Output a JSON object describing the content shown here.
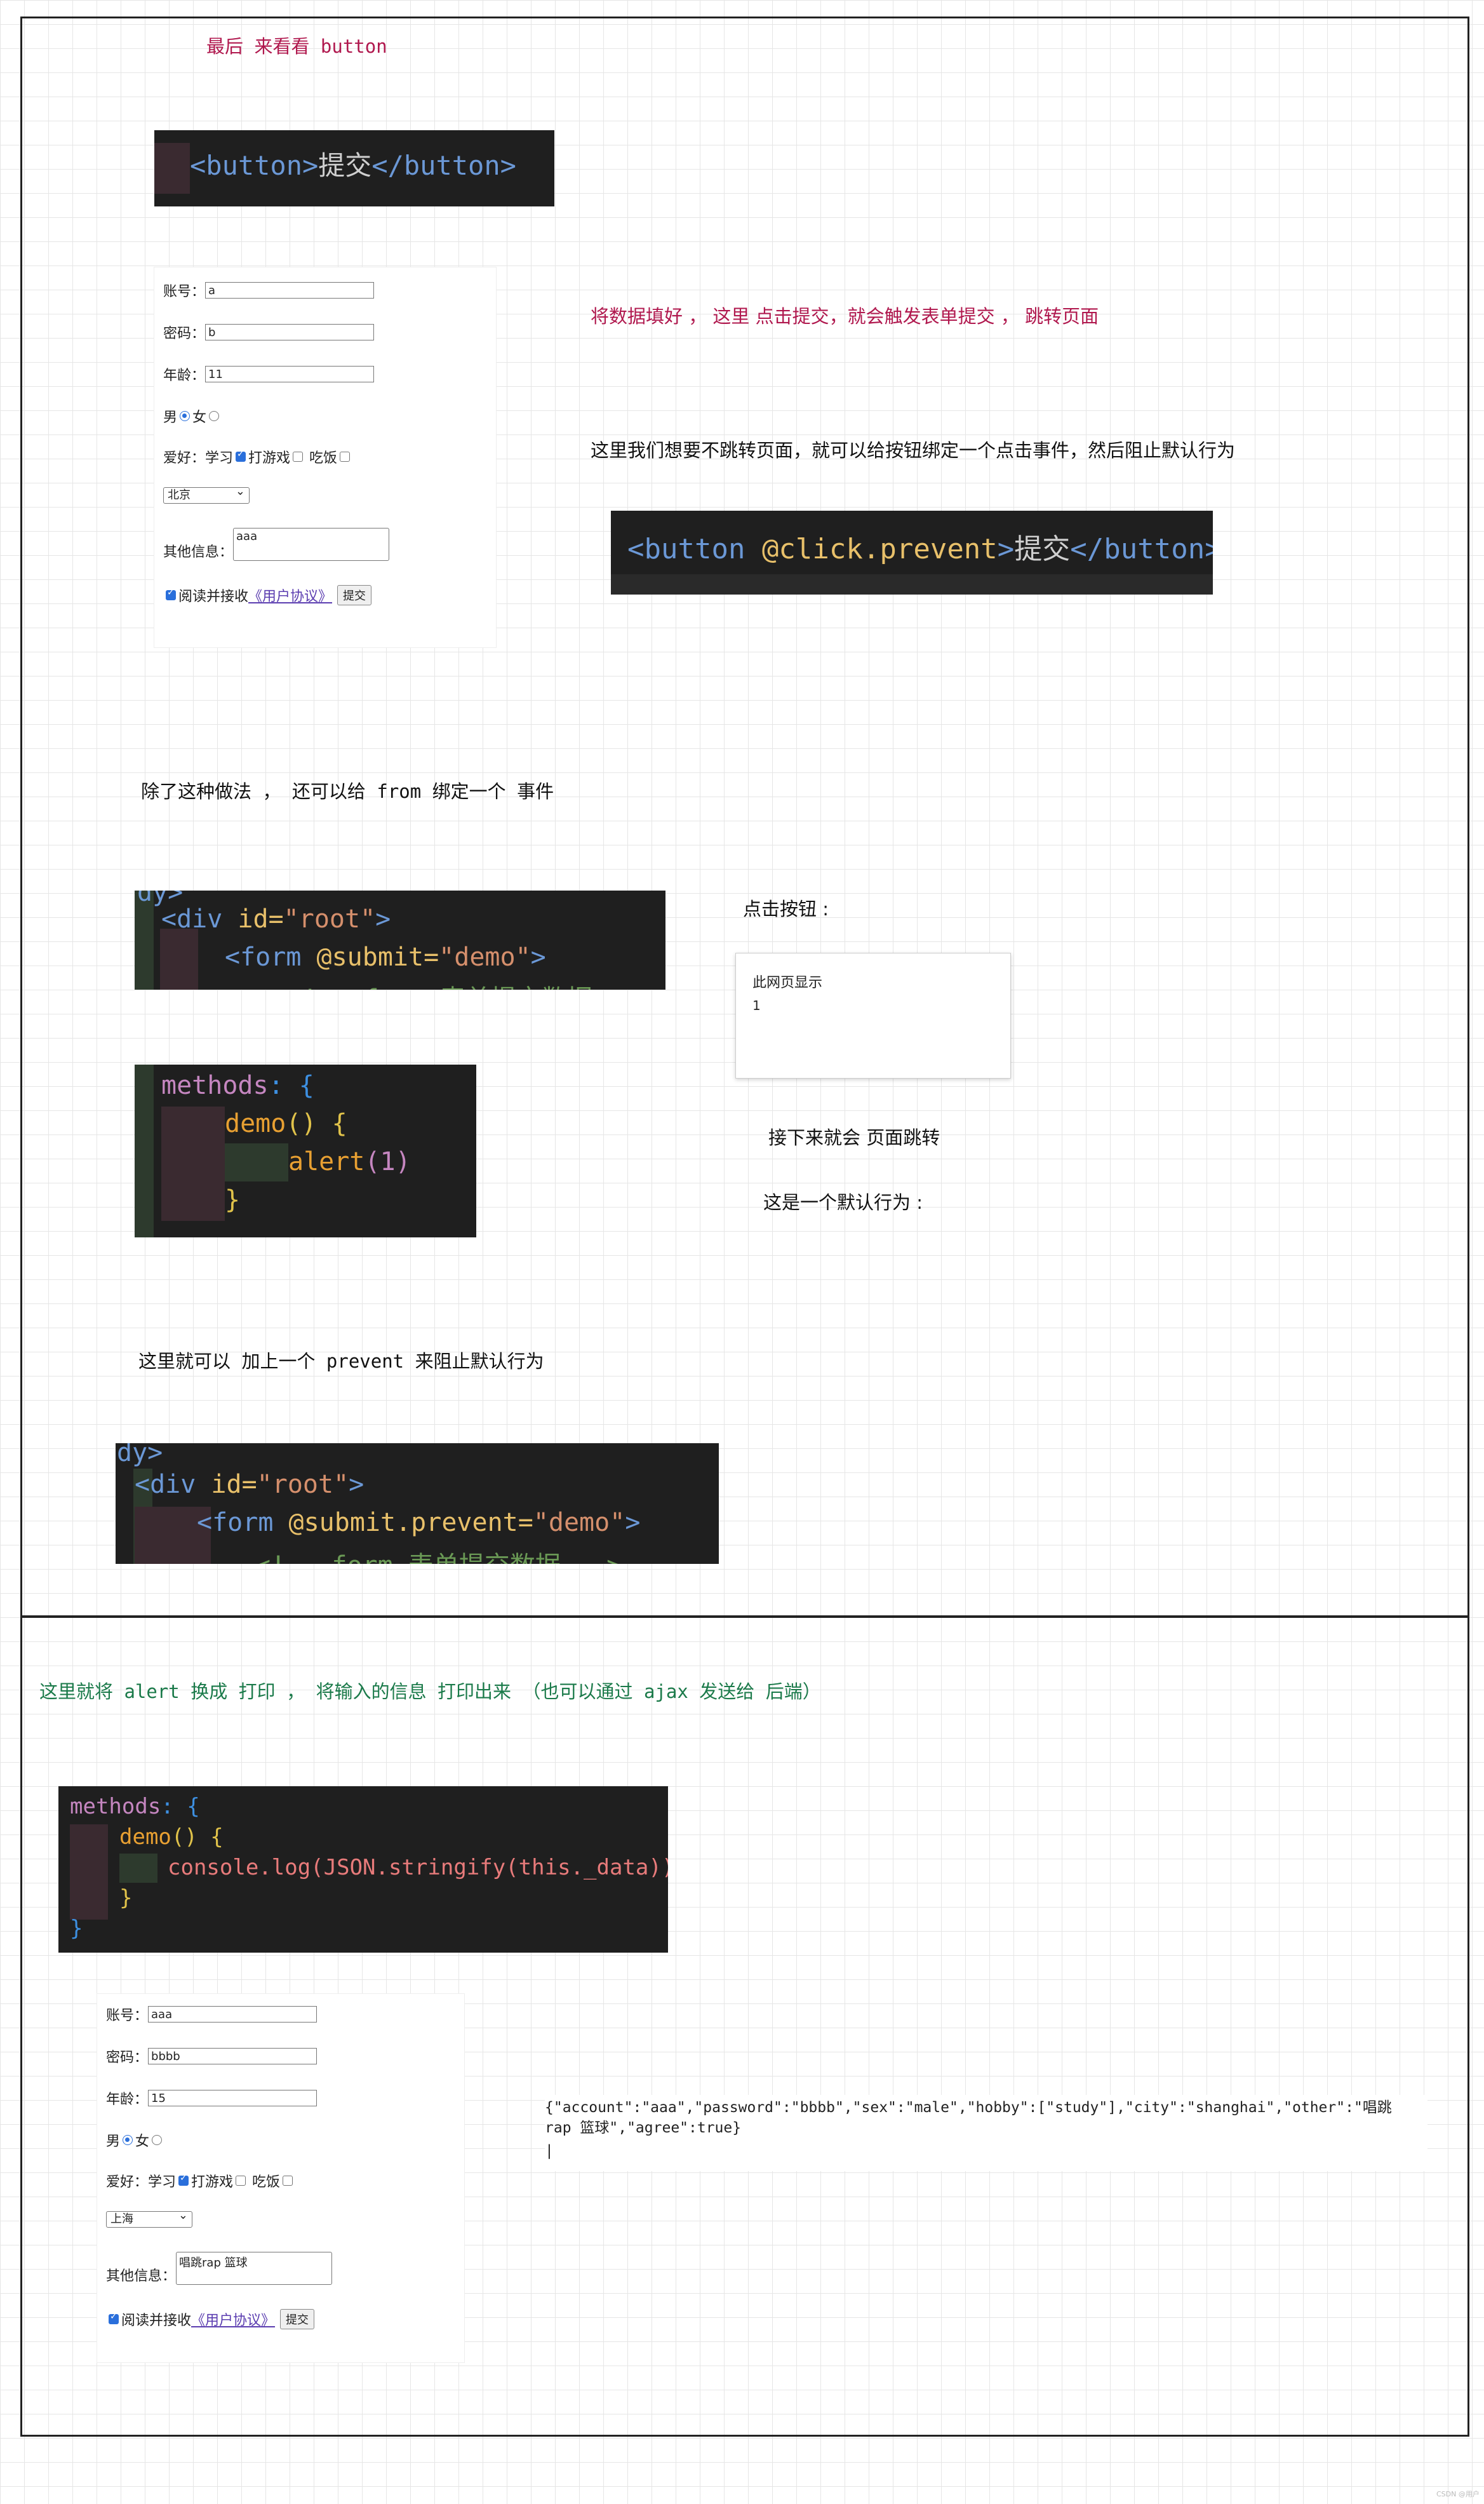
{
  "notes": {
    "finally_button": "最后  来看看  button",
    "fill_data": "将数据填好 ，   这里  点击提交，就会触发表单提交 ，   跳转页面",
    "no_jump": "这里我们想要不跳转页面，就可以给按钮绑定一个点击事件，然后阻止默认行为",
    "besides": "除了这种做法 ， 还可以给  from  绑定一个  事件",
    "click_button": "点击按钮  :",
    "then_jump": "接下来就会  页面跳转",
    "default_behavior": "这是一个默认行为  :",
    "add_prevent": "这里就可以  加上一个  prevent  来阻止默认行为",
    "console_log": "这里就将  alert  换成  打印 ， 将输入的信息  打印出来  （也可以通过  ajax  发送给  后端）"
  },
  "code": {
    "button_plain": {
      "open": "<button>",
      "text": "提交",
      "close": "</button>"
    },
    "button_prevent": {
      "open": "<button ",
      "attr": "@click.prevent",
      "gt": ">",
      "text": "提交",
      "close": "</button>"
    },
    "submit_div": {
      "top": "dy>",
      "l1_tag": "<div ",
      "l1_attr": "id=",
      "l1_str": "\"root\"",
      "l1_end": ">",
      "l2_tag": "<form ",
      "l2_attr": "@submit=",
      "l2_str": "\"demo\"",
      "l2_end": ">",
      "l3": "<!-- form 表单提交数据 -->"
    },
    "methods_alert": {
      "l1_kw": "methods",
      "l1_rest": ": {",
      "l2_fn": "demo",
      "l2_rest": "() {",
      "l3_fn": "alert",
      "l3_arg": "(1)",
      "l4": "}"
    },
    "submit_prevent": {
      "top": "dy>",
      "l1_tag": "<div ",
      "l1_attr": "id=",
      "l1_str": "\"root\"",
      "l1_end": ">",
      "l2_tag": "<form ",
      "l2_attr": "@submit.prevent=",
      "l2_str": "\"demo\"",
      "l2_end": ">",
      "l3": "<!-- form 表单提交数据 -->"
    },
    "methods_log": {
      "l1_kw": "methods",
      "l1_rest": ": {",
      "l2_fn": "demo",
      "l2_rest": "() {",
      "l3": "console.log(JSON.stringify(this._data))",
      "l4": "}",
      "l5": "}"
    }
  },
  "form1": {
    "account_label": "账号：",
    "account_value": "a",
    "password_label": "密码：",
    "password_value": "b",
    "age_label": "年龄：",
    "age_value": "11",
    "male": "男",
    "female": "女",
    "hobby_label": "爱好：学习",
    "hobby_game": "打游戏",
    "hobby_eat": "吃饭",
    "city": "北京",
    "other_label": "其他信息：",
    "other_value": "aaa",
    "agree_text": "阅读并接收",
    "agree_link": "《用户协议》",
    "submit": "提交"
  },
  "form2": {
    "account_label": "账号：",
    "account_value": "aaa",
    "password_label": "密码：",
    "password_value": "bbbb",
    "age_label": "年龄：",
    "age_value": "15",
    "male": "男",
    "female": "女",
    "hobby_label": "爱好：学习",
    "hobby_game": "打游戏",
    "hobby_eat": "吃饭",
    "city": "上海",
    "other_label": "其他信息：",
    "other_value": "唱跳rap 篮球",
    "agree_text": "阅读并接收",
    "agree_link": "《用户协议》",
    "submit": "提交"
  },
  "dialog": {
    "title": "此网页显示",
    "message": "1"
  },
  "console": {
    "line1": "{\"account\":\"aaa\",\"password\":\"bbbb\",\"sex\":\"male\",\"hobby\":[\"study\"],\"city\":\"shanghai\",\"other\":\"唱跳",
    "line2": "rap 篮球\",\"agree\":true}",
    "cursor": "|"
  },
  "footer": "CSDN @用户"
}
